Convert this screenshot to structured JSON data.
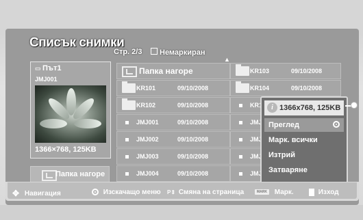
{
  "header": {
    "title": "Списък снимки",
    "page_info": "Стр. 2/3",
    "filter_label": "Немаркиран"
  },
  "preview": {
    "folder_name": "Път1",
    "filename": "JMJ001",
    "resolution": "1366×768, 125KB"
  },
  "folder_up_button": "Папка нагоре",
  "grid": {
    "up_folder": "Папка нагоре",
    "left": [
      {
        "name": "KR101",
        "date": "09/10/2008",
        "kind": "folder"
      },
      {
        "name": "KR102",
        "date": "09/10/2008",
        "kind": "folder"
      },
      {
        "name": "JMJ001",
        "date": "09/10/2008",
        "kind": "file"
      },
      {
        "name": "JMJ002",
        "date": "09/10/2008",
        "kind": "file"
      },
      {
        "name": "JMJ003",
        "date": "09/10/2008",
        "kind": "file"
      },
      {
        "name": "JMJ004",
        "date": "09/10/2008",
        "kind": "file"
      }
    ],
    "right": [
      {
        "name": "KR103",
        "date": "09/10/2008",
        "kind": "folder"
      },
      {
        "name": "KR104",
        "date": "09/10/2008",
        "kind": "folder"
      },
      {
        "name": "KR1",
        "date": "",
        "kind": "file"
      },
      {
        "name": "JMJ",
        "date": "",
        "kind": "file"
      },
      {
        "name": "JMJ",
        "date": "",
        "kind": "file"
      },
      {
        "name": "JMJ",
        "date": "",
        "kind": "file"
      },
      {
        "name": "JMJ",
        "date": "",
        "kind": "file"
      }
    ]
  },
  "popup": {
    "info": "1366x768, 125KB",
    "items": [
      "Преглед",
      "Марк. всички",
      "Изтрий",
      "Затваряне"
    ]
  },
  "footer": {
    "nav": "Навигация",
    "popup_menu": "Изскачащо меню",
    "page_change": "Смяна на страница",
    "mark_badge": "MARK",
    "mark": "Марк.",
    "exit": "Изход"
  }
}
